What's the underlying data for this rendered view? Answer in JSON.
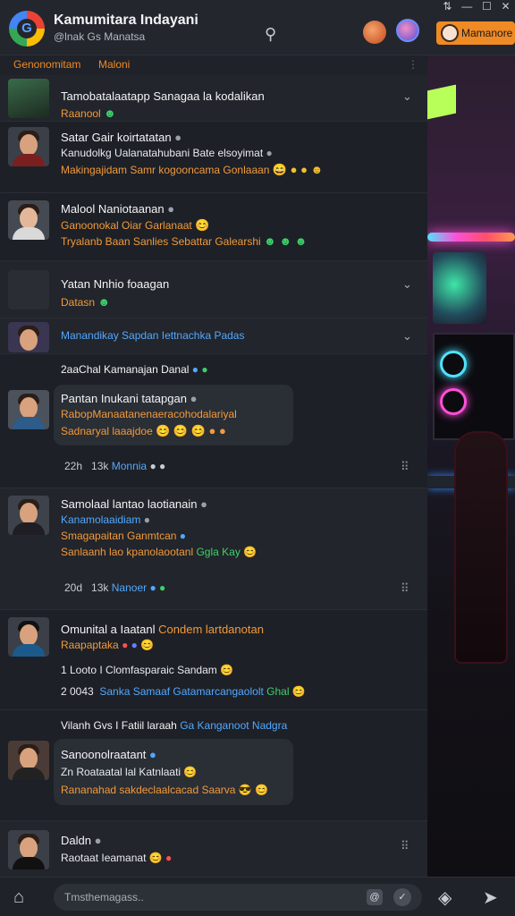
{
  "header": {
    "logo_letter": "G",
    "title": "Kamumitara Indayani",
    "subtitle": "@lnak Gs Manatsa",
    "search_icon": "search-icon",
    "action_button": "Mamanore",
    "window_controls": [
      "⇅",
      "—",
      "☐",
      "✕"
    ]
  },
  "subbar": {
    "left_label": "Genonomitam",
    "right_label": "Maloni",
    "more": "⋮"
  },
  "feed": {
    "rows": [
      {
        "line1": "Tamobatalaatapp Sanagaa la kodalikan",
        "line2": "Raanool",
        "line2_emoji": "☻"
      },
      {
        "line1": "Satar Gair koirtatatan",
        "line2": "Kanudolkg Ualanatahubani Bate elsoyimat",
        "line3": "Makingajidam Samr kogooncama Gonlaaan",
        "line3_emoji": "😄 ● ● ☻"
      },
      {
        "line1": "Malool Naniotaanan",
        "line2": "Ganoonokal Oiar Garlanaat",
        "line2_emoji": "😊",
        "line3": "Tryalanb Baan Sanlies Sebattar Galearshi",
        "line3_emoji": "☻ ☻ ☻"
      },
      {
        "line1": "Yatan Nnhio foaagan",
        "line2": "Datasn",
        "line2_emoji": "☻"
      },
      {
        "line1": "Manandikay Sapdan Iettnachka Padas"
      },
      {
        "line1": "2aaChal Kamanajan Danal"
      },
      {
        "line1": "Pantan Inukani tatapgan",
        "line2": "RabopManaatanenaeracohodalariyal",
        "line3": "Sadnaryal laaajdoe",
        "line3_emoji": "😊 😊 😊 ● ●",
        "meta_time": "22h",
        "meta_count": "13k",
        "meta_label": "Monnia"
      },
      {
        "line1": "Samolaal lantao laotianain",
        "line2": "Kanamolaaidiam",
        "line3": "Smagapaitan Ganmtcan",
        "line4": "Sanlaanh lao kpanolaootanl",
        "line4_tag": "Ggla Kay",
        "meta_time": "20d",
        "meta_count": "13k",
        "meta_label": "Nanoer"
      },
      {
        "line1": "Omunital a Iaatanl",
        "line1_tag": "Condem lartdanotan",
        "line2": "Raapaptaka",
        "line3": "1 Looto I Clomfasparaic Sandam",
        "line4_time": "2 0043",
        "line4": "Sanka Samaaf Gatamarcangaololt",
        "line4_tag": "Ghal"
      },
      {
        "line1": "Vilanh Gvs I Fatiil laraah",
        "line1_tag": "Ga Kanganoot Nadgra"
      },
      {
        "line1": "Sanoonolraatant",
        "line2": "Zn Roataatal lal Katnlaati",
        "line3": "Rananahad sakdeclaalcacad Saarva"
      },
      {
        "line1": "Daldn",
        "line2": "Raotaat Ieamanat"
      }
    ]
  },
  "composer": {
    "placeholder": "Tmsthemagass..",
    "attach_label": "@",
    "emoji_label": "✓"
  },
  "colors": {
    "accent": "#f08a24",
    "link": "#52a8ff",
    "background": "#1d2026"
  }
}
